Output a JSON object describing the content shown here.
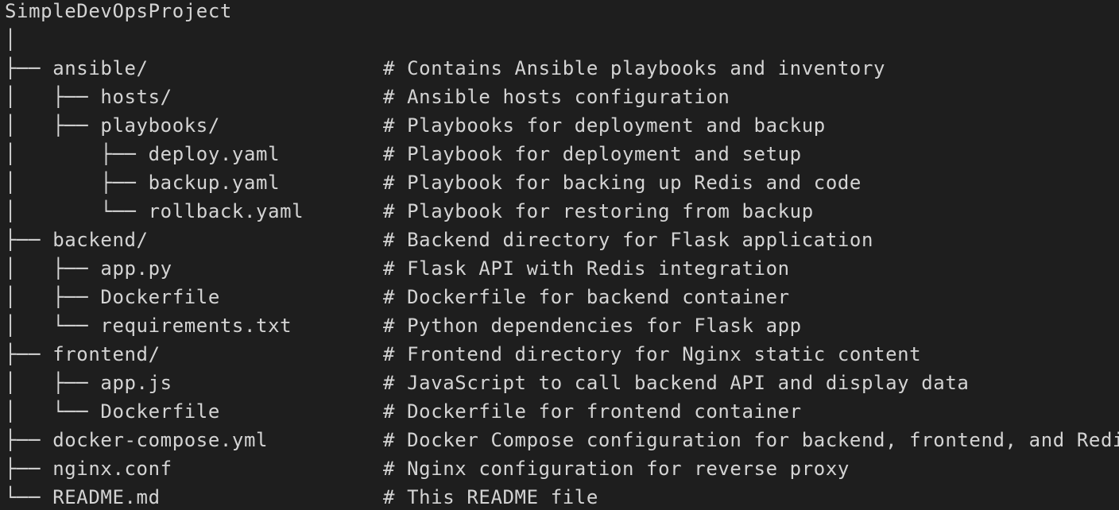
{
  "tree": {
    "lines": [
      {
        "path": "SimpleDevOpsProject",
        "comment": ""
      },
      {
        "path": "│",
        "comment": ""
      },
      {
        "path": "├── ansible/",
        "comment": "# Contains Ansible playbooks and inventory"
      },
      {
        "path": "│   ├── hosts/",
        "comment": "# Ansible hosts configuration"
      },
      {
        "path": "│   ├── playbooks/",
        "comment": "# Playbooks for deployment and backup"
      },
      {
        "path": "│       ├── deploy.yaml",
        "comment": "# Playbook for deployment and setup"
      },
      {
        "path": "│       ├── backup.yaml",
        "comment": "# Playbook for backing up Redis and code"
      },
      {
        "path": "│       └── rollback.yaml",
        "comment": "# Playbook for restoring from backup"
      },
      {
        "path": "├── backend/",
        "comment": "# Backend directory for Flask application"
      },
      {
        "path": "│   ├── app.py",
        "comment": "# Flask API with Redis integration"
      },
      {
        "path": "│   ├── Dockerfile",
        "comment": "# Dockerfile for backend container"
      },
      {
        "path": "│   └── requirements.txt",
        "comment": "# Python dependencies for Flask app"
      },
      {
        "path": "├── frontend/",
        "comment": "# Frontend directory for Nginx static content"
      },
      {
        "path": "│   ├── app.js",
        "comment": "# JavaScript to call backend API and display data"
      },
      {
        "path": "│   └── Dockerfile",
        "comment": "# Dockerfile for frontend container"
      },
      {
        "path": "├── docker-compose.yml",
        "comment": "# Docker Compose configuration for backend, frontend, and Redis"
      },
      {
        "path": "├── nginx.conf",
        "comment": "# Nginx configuration for reverse proxy"
      },
      {
        "path": "└── README.md",
        "comment": "# This README file"
      }
    ]
  }
}
